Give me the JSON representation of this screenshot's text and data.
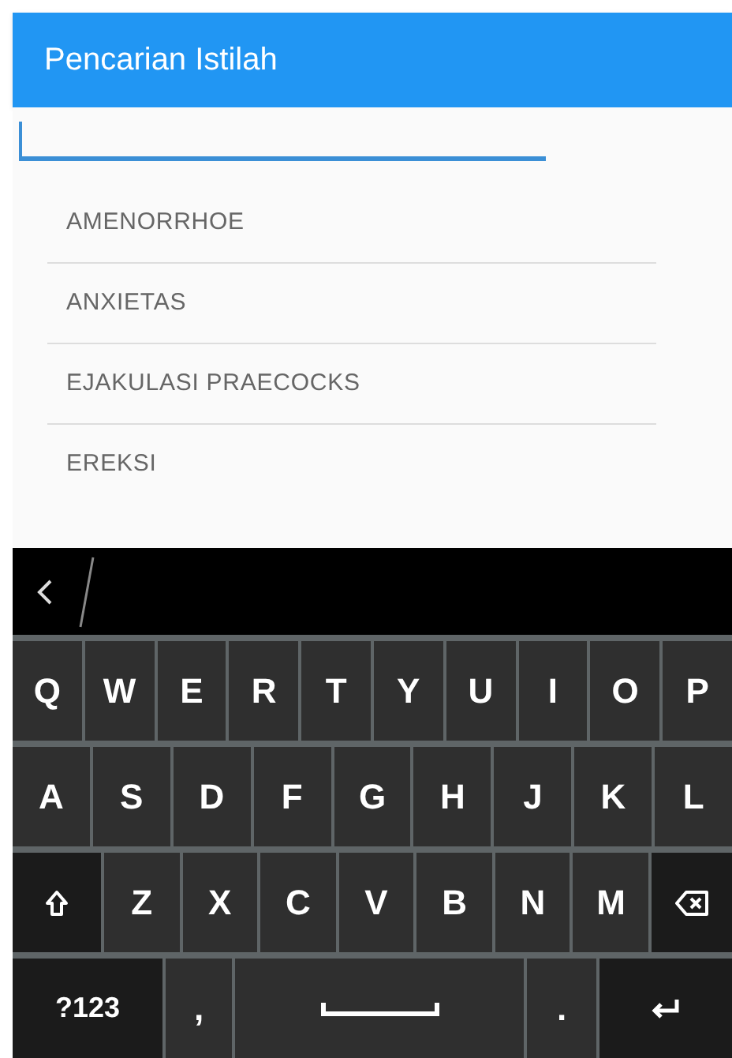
{
  "app_bar": {
    "title": "Pencarian Istilah"
  },
  "search": {
    "focused": true
  },
  "terms": [
    {
      "label": "AMENORRHOE"
    },
    {
      "label": "ANXIETAS"
    },
    {
      "label": "EJAKULASI PRAECOCKS"
    },
    {
      "label": "EREKSI"
    }
  ],
  "keyboard": {
    "rows": [
      {
        "keys": [
          {
            "kind": "char",
            "label": "Q"
          },
          {
            "kind": "char",
            "label": "W"
          },
          {
            "kind": "char",
            "label": "E"
          },
          {
            "kind": "char",
            "label": "R"
          },
          {
            "kind": "char",
            "label": "T"
          },
          {
            "kind": "char",
            "label": "Y"
          },
          {
            "kind": "char",
            "label": "U"
          },
          {
            "kind": "char",
            "label": "I"
          },
          {
            "kind": "char",
            "label": "O"
          },
          {
            "kind": "char",
            "label": "P"
          }
        ]
      },
      {
        "keys": [
          {
            "kind": "char",
            "label": "A"
          },
          {
            "kind": "char",
            "label": "S"
          },
          {
            "kind": "char",
            "label": "D"
          },
          {
            "kind": "char",
            "label": "F"
          },
          {
            "kind": "char",
            "label": "G"
          },
          {
            "kind": "char",
            "label": "H"
          },
          {
            "kind": "char",
            "label": "J"
          },
          {
            "kind": "char",
            "label": "K"
          },
          {
            "kind": "char",
            "label": "L"
          }
        ]
      },
      {
        "keys": [
          {
            "kind": "shift"
          },
          {
            "kind": "char",
            "label": "Z"
          },
          {
            "kind": "char",
            "label": "X"
          },
          {
            "kind": "char",
            "label": "C"
          },
          {
            "kind": "char",
            "label": "V"
          },
          {
            "kind": "char",
            "label": "B"
          },
          {
            "kind": "char",
            "label": "N"
          },
          {
            "kind": "char",
            "label": "M"
          },
          {
            "kind": "backspace"
          }
        ]
      },
      {
        "keys": [
          {
            "kind": "symbols",
            "label": "?123"
          },
          {
            "kind": "char",
            "label": ","
          },
          {
            "kind": "space"
          },
          {
            "kind": "char",
            "label": "."
          },
          {
            "kind": "enter"
          }
        ]
      }
    ]
  }
}
